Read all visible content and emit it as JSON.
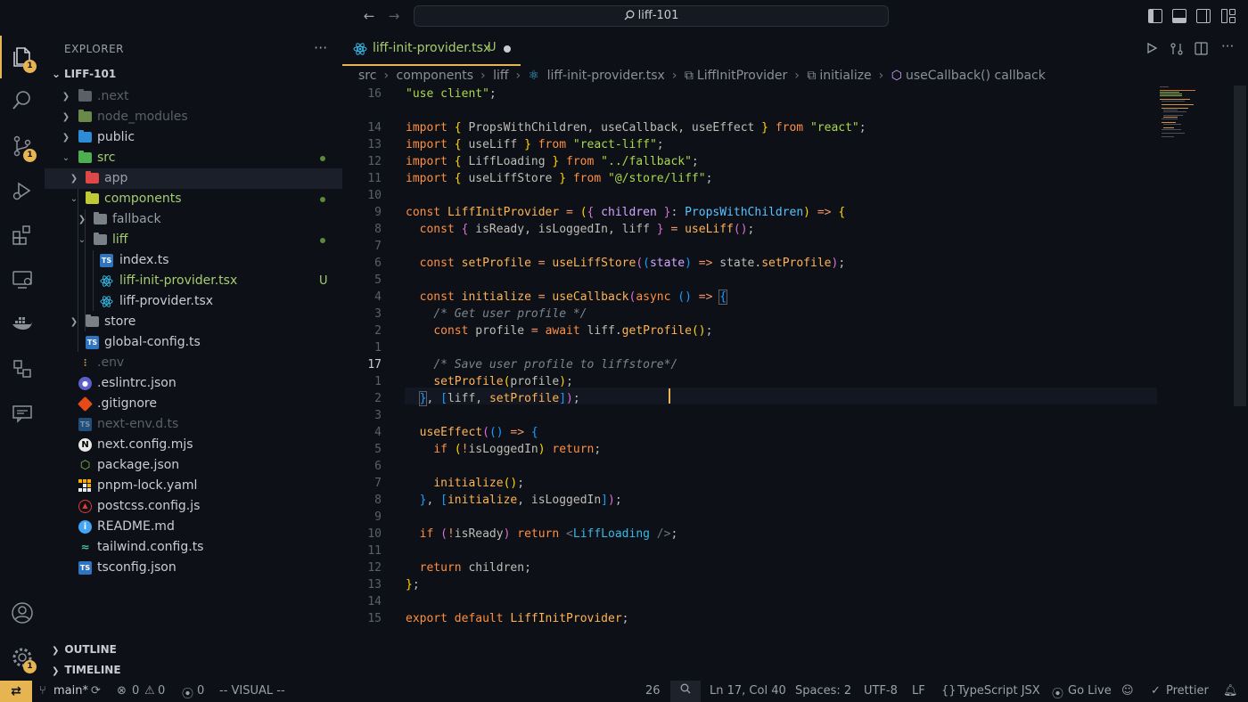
{
  "titlebar": {
    "command_center": "liff-101"
  },
  "activitybar": {
    "explorer_badge": "1",
    "scm_badge": "1",
    "settings_badge": "1"
  },
  "sidebar": {
    "title": "EXPLORER",
    "more": "···",
    "project": "LIFF-101",
    "tree": {
      "next": ".next",
      "node_modules": "node_modules",
      "public": "public",
      "src": "src",
      "app": "app",
      "components": "components",
      "fallback": "fallback",
      "liff": "liff",
      "index_ts": "index.ts",
      "liff_init_provider": "liff-init-provider.tsx",
      "liff_init_provider_status": "U",
      "liff_provider": "liff-provider.tsx",
      "store": "store",
      "global_config": "global-config.ts",
      "env": ".env",
      "eslintrc": ".eslintrc.json",
      "gitignore": ".gitignore",
      "next_env": "next-env.d.ts",
      "next_config": "next.config.mjs",
      "package_json": "package.json",
      "pnpm_lock": "pnpm-lock.yaml",
      "postcss": "postcss.config.js",
      "readme": "README.md",
      "tailwind": "tailwind.config.ts",
      "tsconfig": "tsconfig.json"
    },
    "outline": "OUTLINE",
    "timeline": "TIMELINE"
  },
  "editor": {
    "tab": {
      "label": "liff-init-provider.tsx",
      "status": "U"
    },
    "breadcrumb": {
      "p1": "src",
      "p2": "components",
      "p3": "liff",
      "p4": "liff-init-provider.tsx",
      "p5": "LiffInitProvider",
      "p6": "initialize",
      "p7": "useCallback() callback"
    },
    "line_numbers": [
      "16",
      "",
      "14",
      "13",
      "12",
      "11",
      "10",
      "9",
      "8",
      "7",
      "6",
      "5",
      "4",
      "3",
      "2",
      "1",
      "17",
      "1",
      "2",
      "3",
      "4",
      "5",
      "6",
      "7",
      "8",
      "9",
      "10",
      "11",
      "12",
      "13",
      "14",
      "15"
    ]
  },
  "statusbar": {
    "branch": "main*",
    "errors": "0",
    "warnings": "0",
    "ports": "0",
    "mode": "-- VISUAL --",
    "count": "26",
    "position": "Ln 17, Col 40",
    "spaces": "Spaces: 2",
    "encoding": "UTF-8",
    "eol": "LF",
    "language": "TypeScript JSX",
    "golive": "Go Live",
    "prettier": "Prettier"
  },
  "colors": {
    "accent": "#e6b450",
    "string": "#aad94c",
    "keyword": "#ff8f40",
    "function": "#ffb454",
    "type": "#59c2ff"
  }
}
